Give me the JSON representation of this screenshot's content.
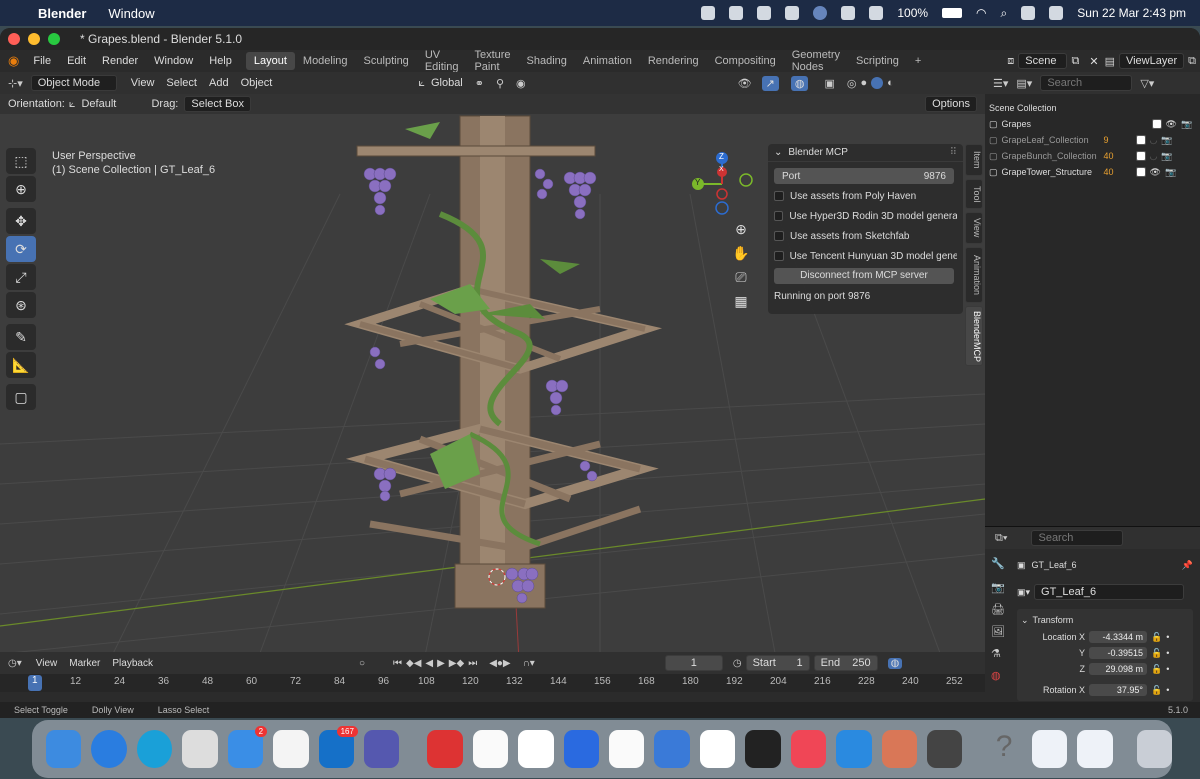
{
  "mac": {
    "apple": "",
    "app": "Blender",
    "menu_window": "Window",
    "battery": "100%",
    "datetime": "Sun 22 Mar  2:43 pm"
  },
  "window": {
    "title": "* Grapes.blend - Blender 5.1.0"
  },
  "topbar": {
    "menus": [
      "File",
      "Edit",
      "Render",
      "Window",
      "Help"
    ],
    "workspaces": [
      "Layout",
      "Modeling",
      "Sculpting",
      "UV Editing",
      "Texture Paint",
      "Shading",
      "Animation",
      "Rendering",
      "Compositing",
      "Geometry Nodes",
      "Scripting"
    ],
    "active_workspace": "Layout",
    "add_tab": "+",
    "scene": "Scene",
    "view_layer": "ViewLayer"
  },
  "header": {
    "mode": "Object Mode",
    "menus": [
      "View",
      "Select",
      "Add",
      "Object"
    ],
    "transform": "Global",
    "orientation_label": "Orientation:",
    "orientation_value": "Default",
    "drag_label": "Drag:",
    "drag_value": "Select Box",
    "options": "Options"
  },
  "viewport": {
    "perspective": "User Perspective",
    "collection_info": "(1) Scene Collection | GT_Leaf_6",
    "gizmo": {
      "z": "Z",
      "y": "Y",
      "x": "X"
    }
  },
  "mcp_panel": {
    "title": "Blender MCP",
    "port_label": "Port",
    "port_value": "9876",
    "options": [
      {
        "label": "Use assets from Poly Haven",
        "checked": false
      },
      {
        "label": "Use Hyper3D Rodin 3D model generati...",
        "checked": false
      },
      {
        "label": "Use assets from Sketchfab",
        "checked": false
      },
      {
        "label": "Use Tencent Hunyuan 3D model gene...",
        "checked": false
      }
    ],
    "disconnect": "Disconnect from MCP server",
    "status": "Running on port 9876"
  },
  "n_tabs": [
    "Item",
    "Tool",
    "View",
    "Animation",
    "BlenderMCP"
  ],
  "active_n_tab": "BlenderMCP",
  "outliner": {
    "search_placeholder": "Search",
    "root": "Scene Collection",
    "items": [
      {
        "name": "Grapes",
        "dim": false,
        "count": ""
      },
      {
        "name": "GrapeLeaf_Collection",
        "dim": true,
        "count": "9"
      },
      {
        "name": "GrapeBunch_Collection",
        "dim": true,
        "count": "40"
      },
      {
        "name": "GrapeTower_Structure",
        "dim": false,
        "count": "40"
      }
    ]
  },
  "properties": {
    "search_placeholder": "Search",
    "object_name": "GT_Leaf_6",
    "data_name": "GT_Leaf_6",
    "section": "Transform",
    "location_label": "Location X",
    "y_label": "Y",
    "z_label": "Z",
    "rotation_label": "Rotation X",
    "loc_x": "-4.3344 m",
    "loc_y": "-0.39515",
    "loc_z": "29.098 m",
    "rot_x": "37.95°"
  },
  "timeline": {
    "menus": [
      "View",
      "Marker",
      "Playback"
    ],
    "current_frame": "1",
    "start_label": "Start",
    "start": "1",
    "end_label": "End",
    "end": "250",
    "ticks": [
      "12",
      "24",
      "36",
      "48",
      "60",
      "72",
      "84",
      "96",
      "108",
      "120",
      "132",
      "144",
      "156",
      "168",
      "180",
      "192",
      "204",
      "216",
      "228",
      "240",
      "252"
    ],
    "frame_marker": "1"
  },
  "status": {
    "items": [
      "Select Toggle",
      "Dolly View",
      "Lasso Select"
    ],
    "version": "5.1.0"
  },
  "dock": {
    "mail_badge": "2",
    "outlook_badge": "167"
  },
  "colors": {
    "accent": "#4772b3",
    "viewport_bg": "#3d3d3d",
    "wood": "#8a7460",
    "grape": "#8a6fc0",
    "leaf": "#5c8c3c"
  }
}
